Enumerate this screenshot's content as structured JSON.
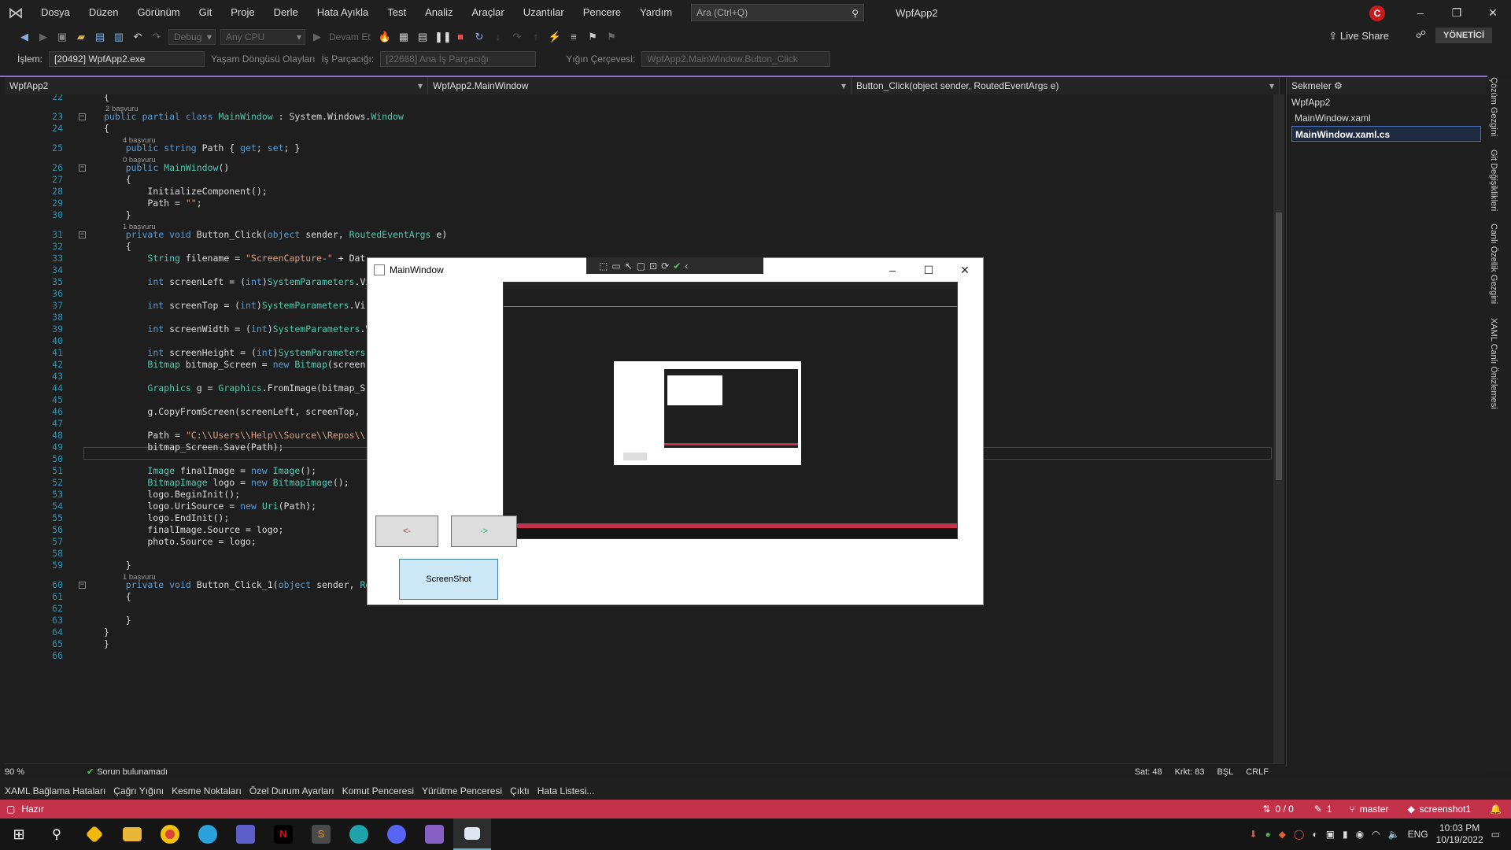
{
  "menubar": {
    "items": [
      "Dosya",
      "Düzen",
      "Görünüm",
      "Git",
      "Proje",
      "Derle",
      "Hata Ayıkla",
      "Test",
      "Analiz",
      "Araçlar",
      "Uzantılar",
      "Pencere",
      "Yardım"
    ],
    "search_placeholder": "Ara (Ctrl+Q)",
    "app_title": "WpfApp2",
    "profile_initial": "C"
  },
  "toolbar": {
    "config": "Debug",
    "platform": "Any CPU",
    "continue_label": "Devam Et",
    "live_share": "Live Share",
    "admin": "YÖNETİCİ"
  },
  "processbar": {
    "process_label": "İşlem:",
    "process_value": "[20492] WpfApp2.exe",
    "lifecycle_label": "Yaşam Döngüsü Olayları",
    "thread_label": "İş Parçacığı:",
    "thread_value": "[22668] Ana İş Parçacığı",
    "stack_label": "Yığın Çerçevesi:",
    "stack_value": "WpfApp2.MainWindow.Button_Click"
  },
  "navbar": {
    "project": "WpfApp2",
    "class": "WpfApp2.MainWindow",
    "member": "Button_Click(object sender, RoutedEventArgs e)"
  },
  "code_lines": [
    {
      "n": "22",
      "text": "{"
    },
    {
      "n": "23",
      "text": "public partial class MainWindow : System.Windows.Window",
      "hint": "2 başvuru"
    },
    {
      "n": "24",
      "text": "{"
    },
    {
      "n": "25",
      "text": "    public string Path { get; set; }",
      "hint": "4 başvuru"
    },
    {
      "n": "26",
      "text": "    public MainWindow()",
      "hint": "0 başvuru"
    },
    {
      "n": "27",
      "text": "    {"
    },
    {
      "n": "28",
      "text": "        InitializeComponent();"
    },
    {
      "n": "29",
      "text": "        Path = \"\";"
    },
    {
      "n": "30",
      "text": "    }"
    },
    {
      "n": "31",
      "text": "    private void Button_Click(object sender, RoutedEventArgs e)",
      "hint": "1 başvuru"
    },
    {
      "n": "32",
      "text": "    {"
    },
    {
      "n": "33",
      "text": "        String filename = \"ScreenCapture-\" + Dat"
    },
    {
      "n": "34",
      "text": ""
    },
    {
      "n": "35",
      "text": "        int screenLeft = (int)SystemParameters.Vi"
    },
    {
      "n": "36",
      "text": ""
    },
    {
      "n": "37",
      "text": "        int screenTop = (int)SystemParameters.Vi"
    },
    {
      "n": "38",
      "text": ""
    },
    {
      "n": "39",
      "text": "        int screenWidth = (int)SystemParameters.V"
    },
    {
      "n": "40",
      "text": ""
    },
    {
      "n": "41",
      "text": "        int screenHeight = (int)SystemParameters"
    },
    {
      "n": "42",
      "text": "        Bitmap bitmap_Screen = new Bitmap(screen"
    },
    {
      "n": "43",
      "text": ""
    },
    {
      "n": "44",
      "text": "        Graphics g = Graphics.FromImage(bitmap_S"
    },
    {
      "n": "45",
      "text": ""
    },
    {
      "n": "46",
      "text": "        g.CopyFromScreen(screenLeft, screenTop, "
    },
    {
      "n": "47",
      "text": ""
    },
    {
      "n": "48",
      "text": "        Path = \"C:\\\\Users\\\\Help\\\\Source\\\\Repos\\\\"
    },
    {
      "n": "49",
      "text": "        bitmap_Screen.Save(Path);"
    },
    {
      "n": "50",
      "text": ""
    },
    {
      "n": "51",
      "text": "        Image finalImage = new Image();"
    },
    {
      "n": "52",
      "text": "        BitmapImage logo = new BitmapImage();"
    },
    {
      "n": "53",
      "text": "        logo.BeginInit();"
    },
    {
      "n": "54",
      "text": "        logo.UriSource = new Uri(Path);"
    },
    {
      "n": "55",
      "text": "        logo.EndInit();"
    },
    {
      "n": "56",
      "text": "        finalImage.Source = logo;"
    },
    {
      "n": "57",
      "text": "        photo.Source = logo;"
    },
    {
      "n": "58",
      "text": ""
    },
    {
      "n": "59",
      "text": "    }"
    },
    {
      "n": "60",
      "text": "    private void Button_Click_1(object sender, RoutedEventArgs e)",
      "hint": "1 başvuru"
    },
    {
      "n": "61",
      "text": "    {"
    },
    {
      "n": "62",
      "text": ""
    },
    {
      "n": "63",
      "text": "    }"
    },
    {
      "n": "64",
      "text": "}"
    },
    {
      "n": "65",
      "text": "}"
    },
    {
      "n": "66",
      "text": ""
    }
  ],
  "rightpanel": {
    "title": "Sekmeler",
    "items": [
      "WpfApp2",
      "MainWindow.xaml",
      "MainWindow.xaml.cs"
    ]
  },
  "sidetabs": [
    "Çözüm Gezgini",
    "Git Değişiklikleri",
    "Canlı Özellik Gezgini",
    "XAML Canlı Önizlemesi"
  ],
  "editorstatus": {
    "zoom": "90 %",
    "issues": "Sorun bulunamadı",
    "line": "Sat: 48",
    "col": "Krkt: 83",
    "indent": "BŞL",
    "eol": "CRLF"
  },
  "bottomtabs": [
    "XAML Bağlama Hataları",
    "Çağrı Yığını",
    "Kesme Noktaları",
    "Özel Durum Ayarları",
    "Komut Penceresi",
    "Yürütme Penceresi",
    "Çıktı",
    "Hata Listesi..."
  ],
  "statusbar": {
    "ready": "Hazır",
    "changes": "0 / 0",
    "edits": "1",
    "branch": "master",
    "repo": "screenshot1"
  },
  "mainwindow": {
    "title": "MainWindow",
    "prev_button": "<-",
    "next_button": "->",
    "screenshot_button": "ScreenShot"
  },
  "tray": {
    "lang": "ENG",
    "time": "10:03 PM",
    "date": "10/19/2022"
  }
}
